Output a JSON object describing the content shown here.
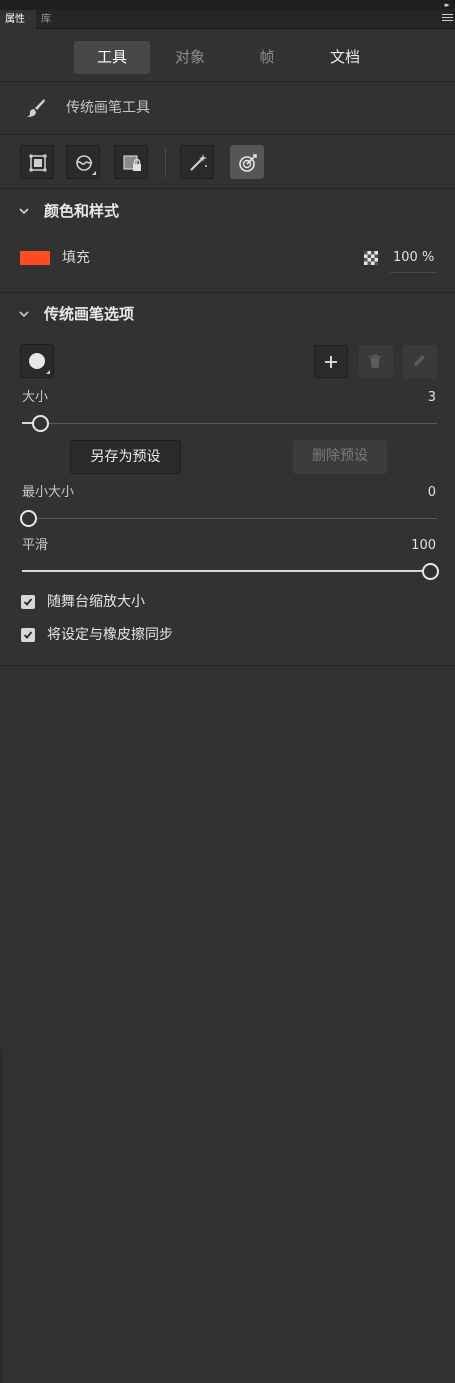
{
  "panel_tabs": [
    {
      "label": "属性"
    },
    {
      "label": "库"
    }
  ],
  "main_tabs": [
    {
      "label": "工具"
    },
    {
      "label": "对象"
    },
    {
      "label": "帧"
    },
    {
      "label": "文档"
    }
  ],
  "tool": {
    "name": "传统画笔工具",
    "icon": "brush-icon"
  },
  "mode_buttons": [
    {
      "icon": "object-drawing-icon",
      "active": false
    },
    {
      "icon": "draw-mode-icon",
      "active": false
    },
    {
      "icon": "lock-fill-icon",
      "active": false
    },
    {
      "icon": "magic-pen-icon",
      "active": false
    },
    {
      "icon": "pressure-icon",
      "active": true
    }
  ],
  "color_style": {
    "title": "颜色和样式",
    "fill_label": "填充",
    "fill_color": "#ff4c1e",
    "opacity": "100 %"
  },
  "brush_options": {
    "title": "传统画笔选项",
    "size": {
      "label": "大小",
      "value": "3",
      "fraction": 0.03
    },
    "save_preset": "另存为预设",
    "delete_preset": "删除预设",
    "min_size": {
      "label": "最小大小",
      "value": "0",
      "fraction": 0.0
    },
    "smooth": {
      "label": "平滑",
      "value": "100",
      "fraction": 1.0
    },
    "scale_with_stage": {
      "label": "随舞台缩放大小",
      "checked": true
    },
    "sync_with_eraser": {
      "label": "将设定与橡皮擦同步",
      "checked": true
    }
  },
  "colors": {
    "background": "#323232",
    "accent_fill": "#ff4c1e"
  }
}
